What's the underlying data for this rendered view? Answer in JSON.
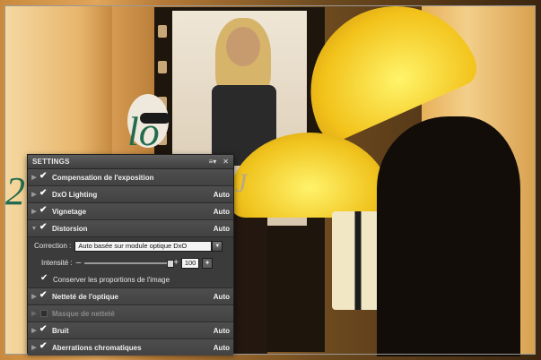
{
  "photo": {
    "letters": [
      "lo",
      "2",
      "J"
    ]
  },
  "panel": {
    "title": "SETTINGS",
    "header_menu_icon": "menu-icon",
    "header_close_icon": "close-icon",
    "rows": [
      {
        "label": "Compensation de l'exposition",
        "checked": true,
        "expanded": false,
        "status": ""
      },
      {
        "label": "DxO Lighting",
        "checked": true,
        "expanded": false,
        "status": "Auto"
      },
      {
        "label": "Vignetage",
        "checked": true,
        "expanded": false,
        "status": "Auto"
      },
      {
        "label": "Distorsion",
        "checked": true,
        "expanded": true,
        "status": "Auto"
      }
    ],
    "distorsion": {
      "correction_label": "Correction :",
      "correction_value": "Auto basée sur module optique DxO",
      "intensity_label": "Intensité :",
      "intensity_minus": "–",
      "intensity_plus": "+",
      "intensity_value": "100",
      "intensity_level": 1.0,
      "keep_proportions_label": "Conserver les proportions de l'image",
      "keep_proportions_checked": true
    },
    "rows_after": [
      {
        "label": "Netteté de l'optique",
        "checked": true,
        "enabled": true,
        "status": "Auto"
      },
      {
        "label": "Masque de netteté",
        "checked": false,
        "enabled": false,
        "status": ""
      },
      {
        "label": "Bruit",
        "checked": true,
        "enabled": true,
        "status": "Auto"
      },
      {
        "label": "Aberrations chromatiques",
        "checked": true,
        "enabled": true,
        "status": "Auto"
      }
    ]
  }
}
